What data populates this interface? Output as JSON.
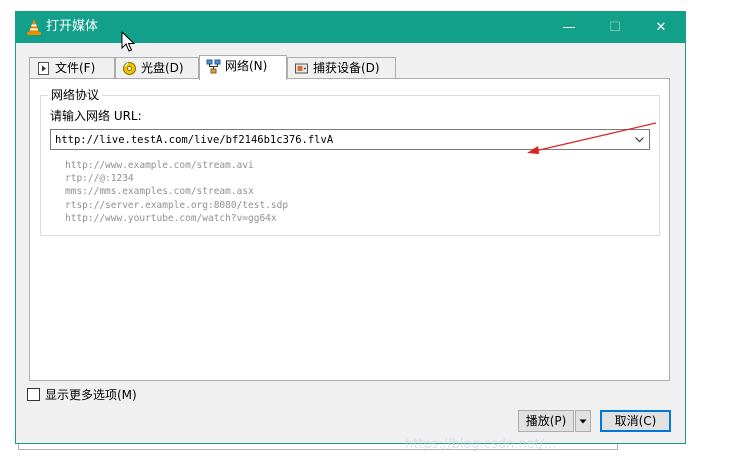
{
  "window": {
    "title": "打开媒体",
    "controls": {
      "minimize": "—",
      "maximize": "☐",
      "close": "✕"
    },
    "accent_color": "#13a08a"
  },
  "tabs": [
    {
      "label": "文件(F)",
      "icon": "file-icon",
      "active": false
    },
    {
      "label": "光盘(D)",
      "icon": "disc-icon",
      "active": false
    },
    {
      "label": "网络(N)",
      "icon": "network-icon",
      "active": true
    },
    {
      "label": "捕获设备(D)",
      "icon": "capture-device-icon",
      "active": false
    }
  ],
  "network": {
    "group_title": "网络协议",
    "url_label": "请输入网络 URL:",
    "url_value": "http://live.testA.com/live/bf2146b1c376.flvA",
    "examples": [
      "http://www.example.com/stream.avi",
      "rtp://@:1234",
      "mms://mms.examples.com/stream.asx",
      "rtsp://server.example.org:8080/test.sdp",
      "http://www.yourtube.com/watch?v=gg64x"
    ]
  },
  "options": {
    "more_options_label": "显示更多选项(M)",
    "more_options_checked": false
  },
  "buttons": {
    "play_label": "播放(P)",
    "cancel_label": "取消(C)"
  },
  "annotation": {
    "arrow_color": "#e02020"
  },
  "watermark": "https://blog.csdn.net/..."
}
